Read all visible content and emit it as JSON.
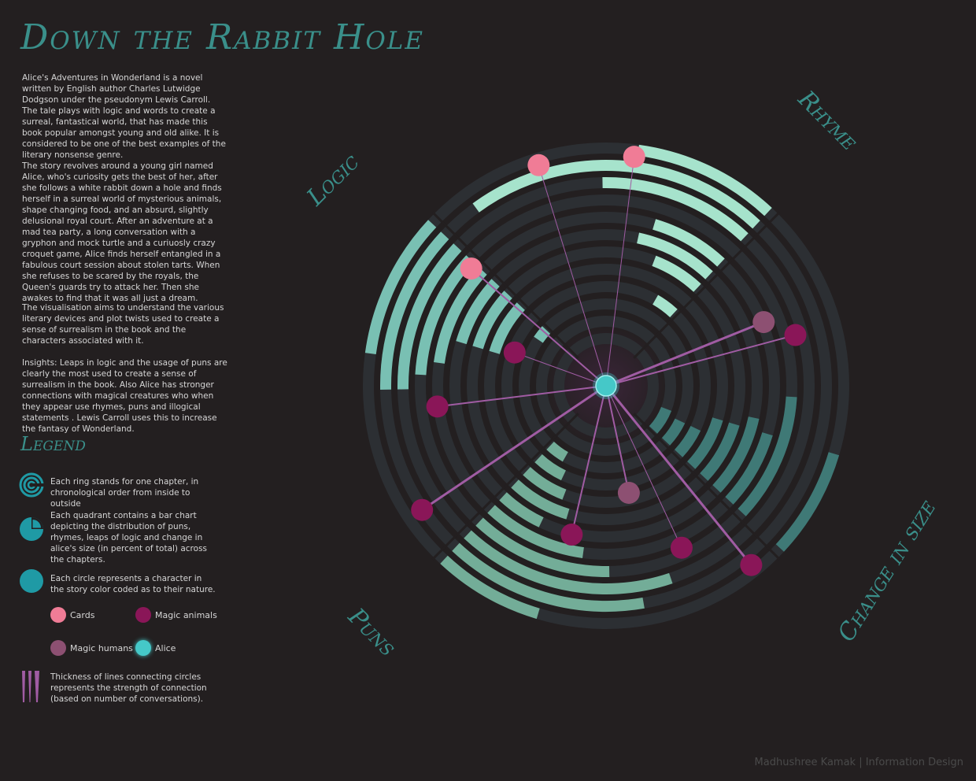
{
  "title": "Down the Rabbit Hole",
  "paragraphs": [
    "Alice's Adventures in Wonderland  is a novel written by English author Charles Lutwidge Dodgson under the pseudonym Lewis Carroll.  The tale plays with logic and words to create a surreal, fantastical world, that has made this book popular amongst young and old alike. It is considered to be one of the best examples of the literary nonsense genre.",
    "The story revolves around a young girl named Alice, who's curiosity gets the best of her, after she follows a white rabbit down a hole and finds herself in a surreal world of mysterious animals, shape changing food, and an absurd, slightly delusional royal court. After an adventure at a mad tea party, a long conversation with a gryphon and mock turtle and a curiuosly crazy croquet game, Alice finds herself entangled in a fabulous court session about stolen tarts. When she refuses to be scared by the royals, the Queen's guards try to attack her. Then she awakes to find that it was all just a dream.",
    "The visualisation aims to understand the various literary devices and plot twists used to create a sense of surrealism in the book and the characters associated with it.",
    "Insights: Leaps in logic and the usage of puns are clearly the most used to create a sense of surrealism in the book. Also  Alice has stronger connections with magical creatures who when they appear use rhymes, puns and illogical statements . Lewis Carroll uses this to increase the fantasy of Wonderland."
  ],
  "legend": {
    "title": "Legend",
    "ring_text": "Each ring stands for one chapter, in chronological order from inside to outside",
    "quadrant_text": "Each quadrant contains a bar chart depicting the distribution of puns, rhymes, leaps of logic and change in alice's size (in percent of total) across the chapters.",
    "circle_text": "Each circle represents a character in the story color coded as to their nature.",
    "categories": [
      {
        "label": "Cards",
        "color": "#f07c96"
      },
      {
        "label": "Magic animals",
        "color": "#8a1658"
      },
      {
        "label": "Magic humans",
        "color": "#8d5072"
      },
      {
        "label": "Alice",
        "color": "#45c8c8"
      }
    ],
    "thickness_text": "Thickness of lines connecting circles represents the strength of connection (based on number of conversations)."
  },
  "credit": "Madhushree Kamak | Information Design",
  "colors": {
    "background": "#231f20",
    "ring": "#2c2f33",
    "logic": "#79c0b3",
    "rhyme": "#a6e3cc",
    "puns": "#73ad98",
    "change_in_size": "#3f7976",
    "link": "#a05ca3",
    "title": "#3a8f8a"
  },
  "chart_data": {
    "type": "radial",
    "chapters": 12,
    "quadrants": [
      {
        "name": "Rhyme",
        "values": [
          0,
          0,
          0,
          3,
          0,
          5,
          7,
          6,
          0,
          10,
          18,
          8
        ]
      },
      {
        "name": "Logic",
        "values": [
          0,
          0,
          2,
          0,
          6,
          6,
          6,
          8,
          9,
          10,
          10,
          8
        ]
      },
      {
        "name": "Puns",
        "values": [
          0,
          0,
          3,
          4,
          5,
          6,
          4,
          8,
          10,
          14,
          12,
          6
        ]
      },
      {
        "name": "Change in size",
        "values": [
          0,
          5,
          4,
          4,
          6,
          6,
          7,
          6,
          9,
          0,
          0,
          6
        ]
      }
    ],
    "characters": [
      {
        "type": "Alice",
        "chapter_radius": 0,
        "angle_deg": 0,
        "weight": 3
      },
      {
        "type": "Cards",
        "chapter_radius": 11.5,
        "angle_deg": -107,
        "weight": 1
      },
      {
        "type": "Cards",
        "chapter_radius": 11.5,
        "angle_deg": -83,
        "weight": 1
      },
      {
        "type": "Cards",
        "chapter_radius": 8.5,
        "angle_deg": -139,
        "weight": 2
      },
      {
        "type": "Magic humans",
        "chapter_radius": 8.0,
        "angle_deg": -22,
        "weight": 3
      },
      {
        "type": "Magic animals",
        "chapter_radius": 9.5,
        "angle_deg": -15,
        "weight": 2
      },
      {
        "type": "Magic animals",
        "chapter_radius": 3.8,
        "angle_deg": -160,
        "weight": 1
      },
      {
        "type": "Magic animals",
        "chapter_radius": 8.0,
        "angle_deg": 173,
        "weight": 2
      },
      {
        "type": "Magic animals",
        "chapter_radius": 11.0,
        "angle_deg": 146,
        "weight": 3
      },
      {
        "type": "Magic animals",
        "chapter_radius": 7.0,
        "angle_deg": 103,
        "weight": 2
      },
      {
        "type": "Magic humans",
        "chapter_radius": 4.5,
        "angle_deg": 78,
        "weight": 2
      },
      {
        "type": "Magic animals",
        "chapter_radius": 8.5,
        "angle_deg": 65,
        "weight": 1
      },
      {
        "type": "Magic animals",
        "chapter_radius": 11.5,
        "angle_deg": 51,
        "weight": 3
      }
    ]
  }
}
